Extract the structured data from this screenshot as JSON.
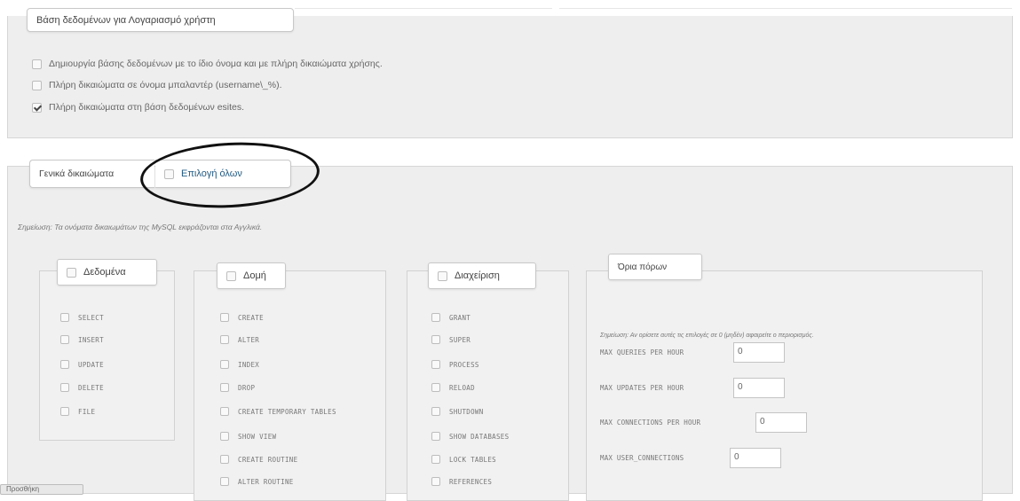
{
  "db_section": {
    "legend": "Βάση δεδομένων για Λογαριασμό χρήστη",
    "options": [
      {
        "label": "Δημιουργία βάσης δεδομένων με το ίδιο όνομα και με πλήρη δικαιώματα χρήσης.",
        "checked": false
      },
      {
        "label": "Πλήρη δικαιώματα σε όνομα μπαλαντέρ (username\\_%).",
        "checked": false
      },
      {
        "label": "Πλήρη δικαιώματα στη βάση δεδομένων esites.",
        "checked": true
      }
    ]
  },
  "global_section": {
    "legend": "Γενικά δικαιώματα",
    "select_all_label": "Επιλογή όλων",
    "note": "Σημείωση: Τα ονόματα δικαιωμάτων της MySQL εκφράζονται στα Αγγλικά.",
    "data_group": {
      "legend": "Δεδομένα",
      "items": [
        "SELECT",
        "INSERT",
        "UPDATE",
        "DELETE",
        "FILE"
      ]
    },
    "structure_group": {
      "legend": "Δομή",
      "items": [
        "CREATE",
        "ALTER",
        "INDEX",
        "DROP",
        "CREATE TEMPORARY TABLES",
        "SHOW VIEW",
        "CREATE ROUTINE",
        "ALTER ROUTINE"
      ]
    },
    "admin_group": {
      "legend": "Διαχείριση",
      "items": [
        "GRANT",
        "SUPER",
        "PROCESS",
        "RELOAD",
        "SHUTDOWN",
        "SHOW DATABASES",
        "LOCK TABLES",
        "REFERENCES"
      ]
    },
    "limits_group": {
      "legend": "Όρια πόρων",
      "note": "Σημείωση: Αν ορίσετε αυτές τις επιλογές σε 0 (μηδέν) αφαιρείτε ο περιορισμός.",
      "fields": [
        {
          "label": "MAX QUERIES PER HOUR",
          "value": "0"
        },
        {
          "label": "MAX UPDATES PER HOUR",
          "value": "0"
        },
        {
          "label": "MAX CONNECTIONS PER HOUR",
          "value": "0"
        },
        {
          "label": "MAX USER_CONNECTIONS",
          "value": "0"
        }
      ]
    }
  },
  "bottom_tab": "Προσθήκη"
}
